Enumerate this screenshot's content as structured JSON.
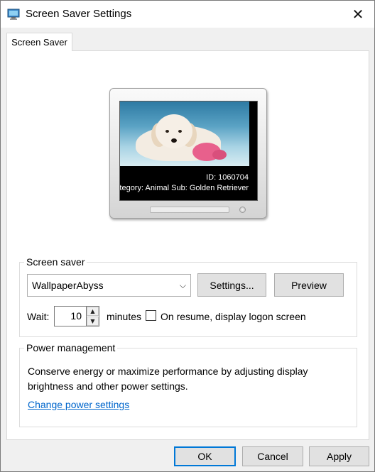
{
  "window": {
    "title": "Screen Saver Settings",
    "close_glyph": "✕",
    "title_icon": "display-settings-icon"
  },
  "tabs": [
    {
      "label": "Screen Saver",
      "selected": true
    }
  ],
  "preview_monitor": {
    "overlay_id": "ID: 1060704",
    "overlay_category": "ategory: Animal Sub: Golden Retriever"
  },
  "screen_saver_group": {
    "label": "Screen saver",
    "selected_saver": "WallpaperAbyss",
    "settings_button": "Settings...",
    "preview_button": "Preview",
    "wait_label": "Wait:",
    "wait_value": "10",
    "minutes_label": "minutes",
    "resume_checkbox_label": "On resume, display logon screen",
    "resume_checked": false
  },
  "power_group": {
    "label": "Power management",
    "description": "Conserve energy or maximize performance by adjusting display brightness and other power settings.",
    "link": "Change power settings"
  },
  "footer": {
    "ok": "OK",
    "cancel": "Cancel",
    "apply": "Apply"
  },
  "colors": {
    "accent": "#0078d7",
    "link": "#0066cc",
    "panel_bg": "#ffffff",
    "window_bg": "#f0f0f0"
  }
}
